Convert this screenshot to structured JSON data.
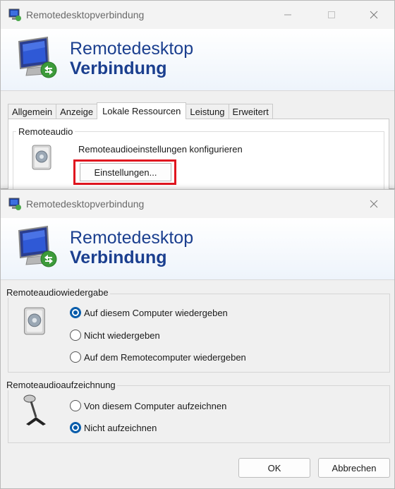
{
  "window1": {
    "title": "Remotedesktopverbindung",
    "banner_line1": "Remotedesktop",
    "banner_line2": "Verbindung",
    "tabs": [
      {
        "label": "Allgemein"
      },
      {
        "label": "Anzeige"
      },
      {
        "label": "Lokale Ressourcen"
      },
      {
        "label": "Leistung"
      },
      {
        "label": "Erweitert"
      }
    ],
    "active_tab": "Lokale Ressourcen",
    "remote_audio": {
      "group_label": "Remoteaudio",
      "description": "Remoteaudioeinstellungen konfigurieren",
      "settings_button": "Einstellungen..."
    },
    "highlight_color": "#e0151f"
  },
  "window2": {
    "title": "Remotedesktopverbindung",
    "banner_line1": "Remotedesktop",
    "banner_line2": "Verbindung",
    "playback": {
      "group_label": "Remoteaudiowiedergabe",
      "options": [
        {
          "label": "Auf diesem Computer wiedergeben",
          "checked": true
        },
        {
          "label": "Nicht wiedergeben",
          "checked": false
        },
        {
          "label": "Auf dem Remotecomputer wiedergeben",
          "checked": false
        }
      ]
    },
    "recording": {
      "group_label": "Remoteaudioaufzeichnung",
      "options": [
        {
          "label": "Von diesem Computer aufzeichnen",
          "checked": false
        },
        {
          "label": "Nicht aufzeichnen",
          "checked": true
        }
      ]
    },
    "ok_button": "OK",
    "cancel_button": "Abbrechen"
  },
  "icons": {
    "app": "rdp-app-icon",
    "logo": "rdp-monitor-logo",
    "speaker": "speaker-icon",
    "microphone": "microphone-icon"
  }
}
